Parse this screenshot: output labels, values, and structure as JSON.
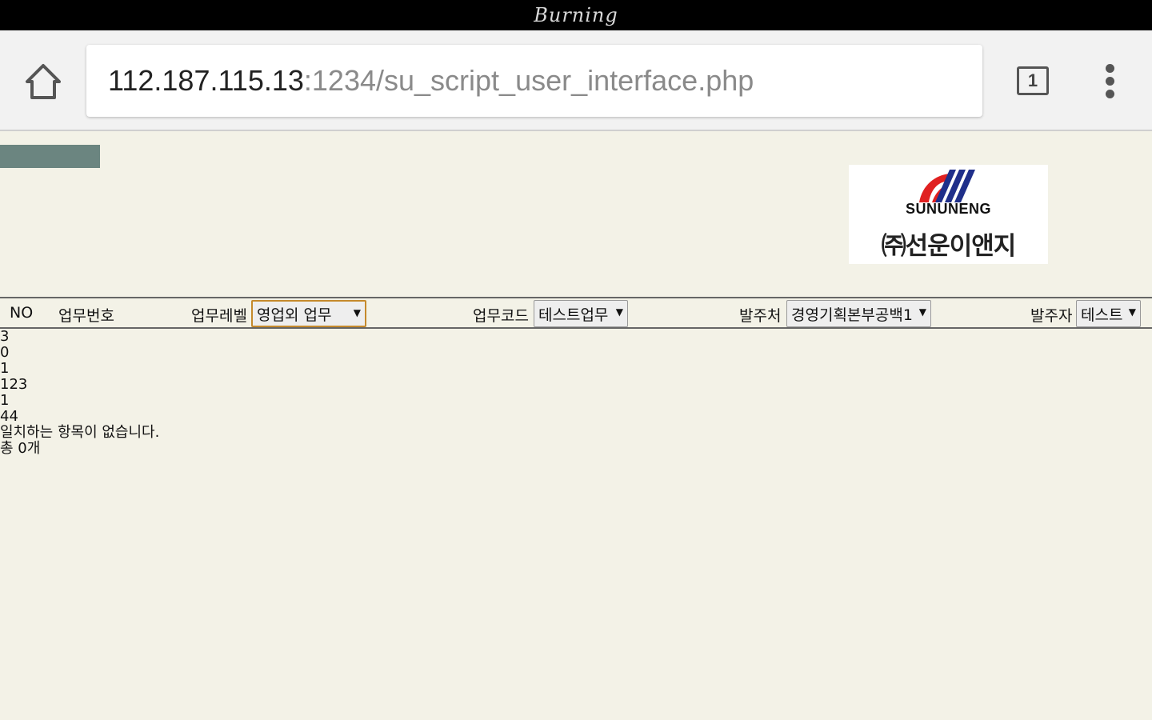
{
  "status_bar": {
    "title": "Burning"
  },
  "browser": {
    "url_host": "112.187.115.13",
    "url_path": ":1234/su_script_user_interface.php",
    "tab_count": "1",
    "icons": {
      "home": "home-icon",
      "menu": "more-vert-icon"
    }
  },
  "logo": {
    "english": "SUNUNENG",
    "korean": "㈜선운이앤지",
    "colors": {
      "red": "#e02020",
      "navy": "#1f2f8a"
    }
  },
  "filter_bar": {
    "no_header": "NO",
    "work_number_header": "업무번호",
    "work_level_label": "업무레벨",
    "work_level_value": "영업외 업무",
    "work_code_label": "업무코드",
    "work_code_value": "테스트업무",
    "client_label": "발주처",
    "client_value": "경영기획본부공백1",
    "orderer_label": "발주자",
    "orderer_value": "테스트"
  },
  "results": {
    "lines": [
      "3",
      "0",
      "1",
      "123",
      "1",
      "44"
    ],
    "no_match": "일치하는 항목이 없습니다.",
    "total": "총 0개"
  },
  "colors": {
    "page_bg": "#f3f2e7",
    "strip": "#6b8580",
    "focus_border": "#c58a2c"
  }
}
